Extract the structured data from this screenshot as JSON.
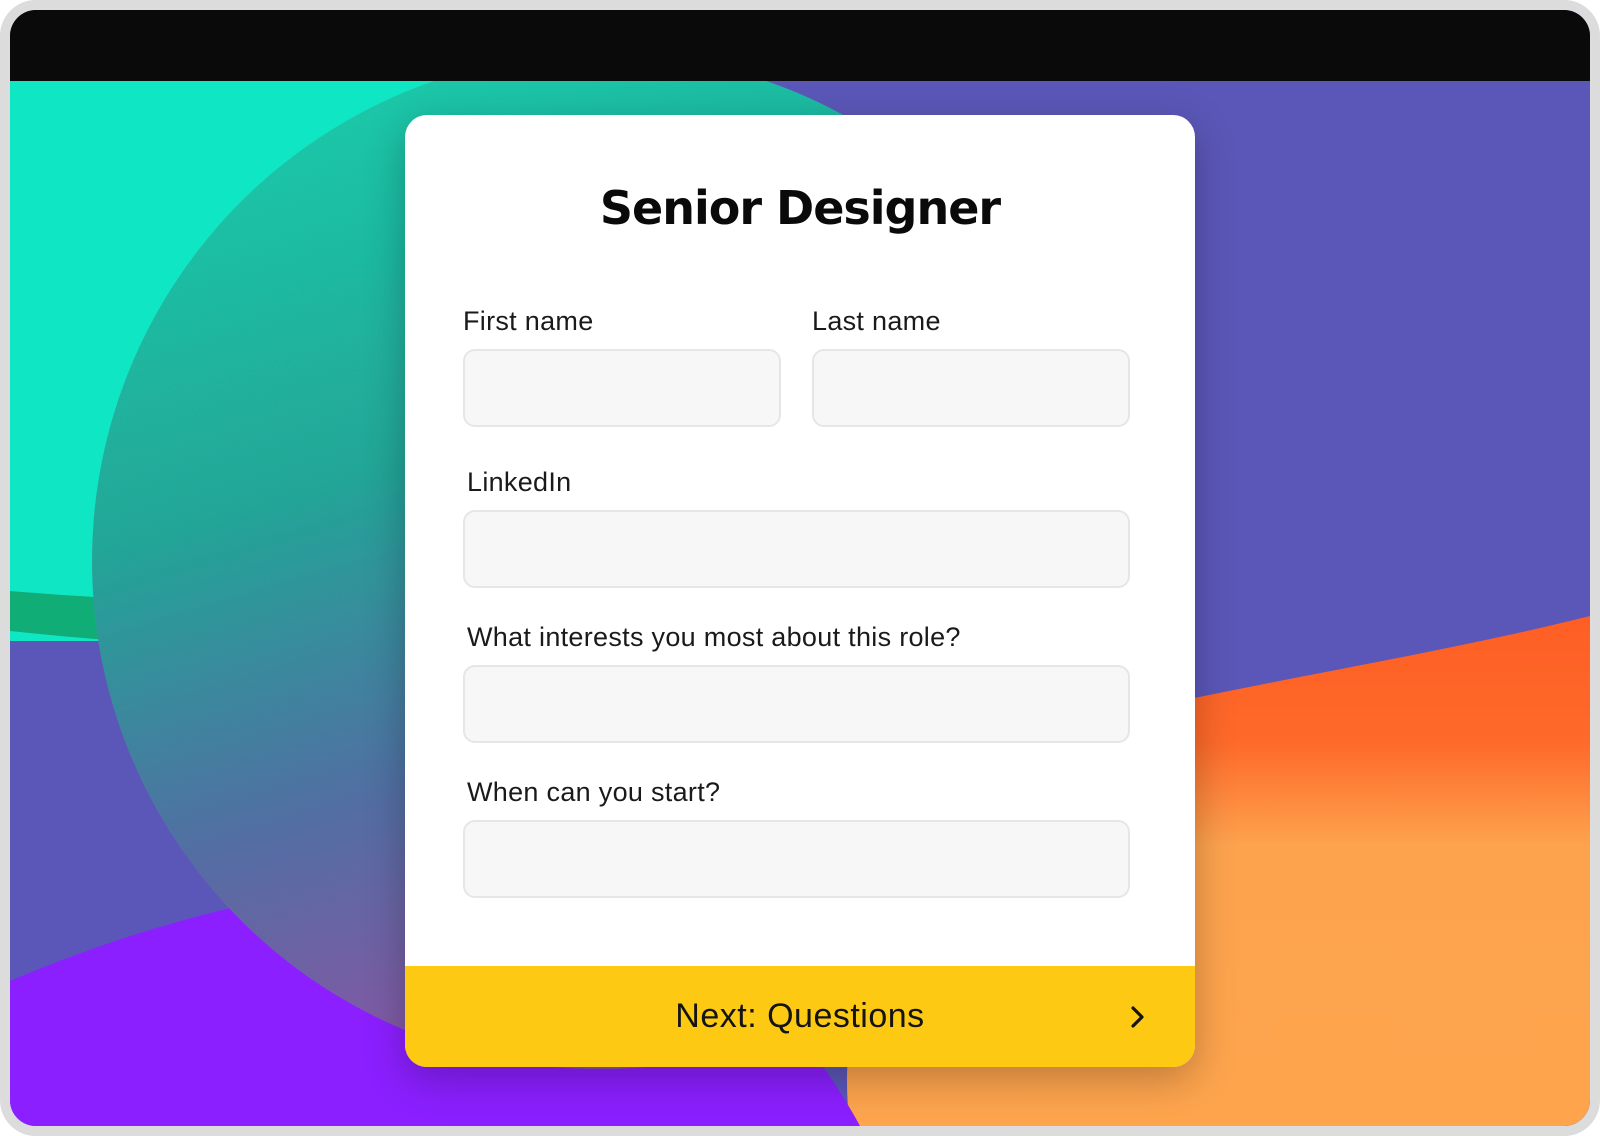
{
  "form": {
    "title": "Senior Designer",
    "fields": {
      "first_name": {
        "label": "First name",
        "value": ""
      },
      "last_name": {
        "label": "Last name",
        "value": ""
      },
      "linkedin": {
        "label": "LinkedIn",
        "value": ""
      },
      "interest": {
        "label": "What interests you most about this role?",
        "value": ""
      },
      "start": {
        "label": "When can you start?",
        "value": ""
      }
    },
    "next_button": {
      "label": "Next: Questions",
      "icon": "chevron-right-icon"
    }
  },
  "colors": {
    "button": "#fdc913",
    "teal": "#0fe6c4",
    "indigo": "#5b57b8",
    "orange": "#fe6a2a",
    "purple": "#8b1fff",
    "topbar": "#0a0a0a"
  }
}
